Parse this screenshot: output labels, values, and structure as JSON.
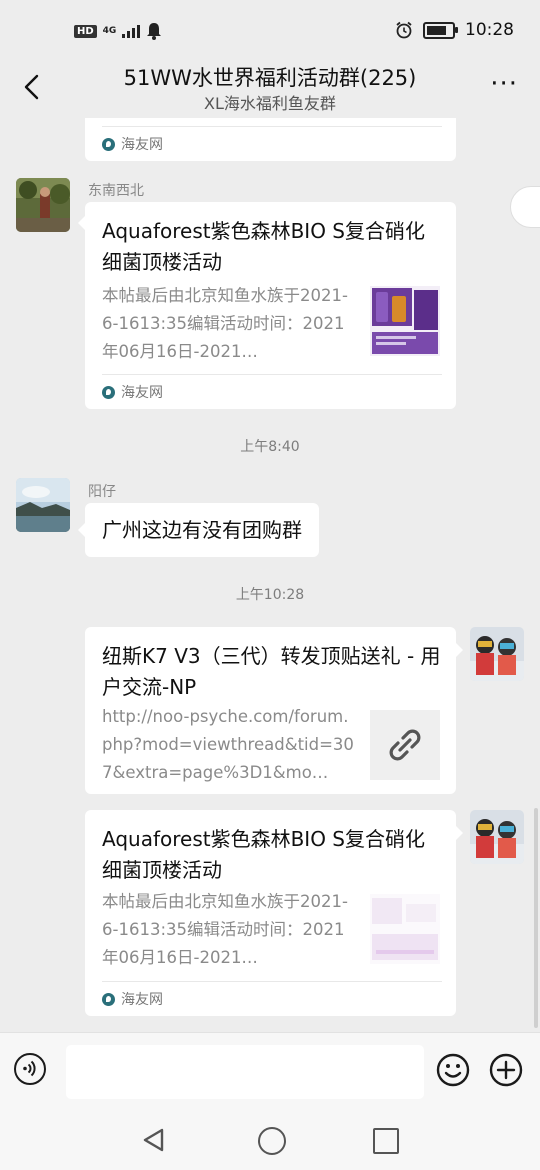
{
  "status_bar": {
    "hd": "HD",
    "network": "4G",
    "time": "10:28",
    "battery_level": 0.85
  },
  "header": {
    "title": "51WW水世界福利活动群(225)",
    "subtitle": "XL海水福利鱼友群",
    "more_label": "···"
  },
  "messages": {
    "partial_card": {
      "source": "海友网"
    },
    "card1": {
      "sender": "东南西北",
      "title": "Aquaforest紫色森林BIO S复合硝化细菌顶楼活动",
      "desc": "本帖最后由北京知鱼水族于2021-6-1613:35编辑活动时间：2021年06月16日-2021…",
      "source": "海友网"
    },
    "time1": "上午8:40",
    "text1": {
      "sender": "阳仔",
      "text": "广州这边有没有团购群"
    },
    "time2": "上午10:28",
    "card2": {
      "title": "纽斯K7 V3（三代）转发顶贴送礼 - 用户交流-NP",
      "desc": "http://noo-psyche.com/forum.php?mod=viewthread&tid=307&extra=page%3D1&mo…",
      "thumb_icon": "link-icon"
    },
    "card3": {
      "title": "Aquaforest紫色森林BIO S复合硝化细菌顶楼活动",
      "desc": "本帖最后由北京知鱼水族于2021-6-1613:35编辑活动时间：2021年06月16日-2021…",
      "source": "海友网"
    }
  },
  "input_bar": {
    "voice_icon": "voice-icon",
    "emoji_icon": "emoji-icon",
    "plus_icon": "plus-icon",
    "placeholder": ""
  },
  "nav": {
    "back_icon": "triangle-back-icon",
    "home_icon": "circle-home-icon",
    "recent_icon": "square-recent-icon"
  },
  "colors": {
    "background": "#ededed",
    "bubble": "#ffffff",
    "meta_text": "#888888"
  }
}
